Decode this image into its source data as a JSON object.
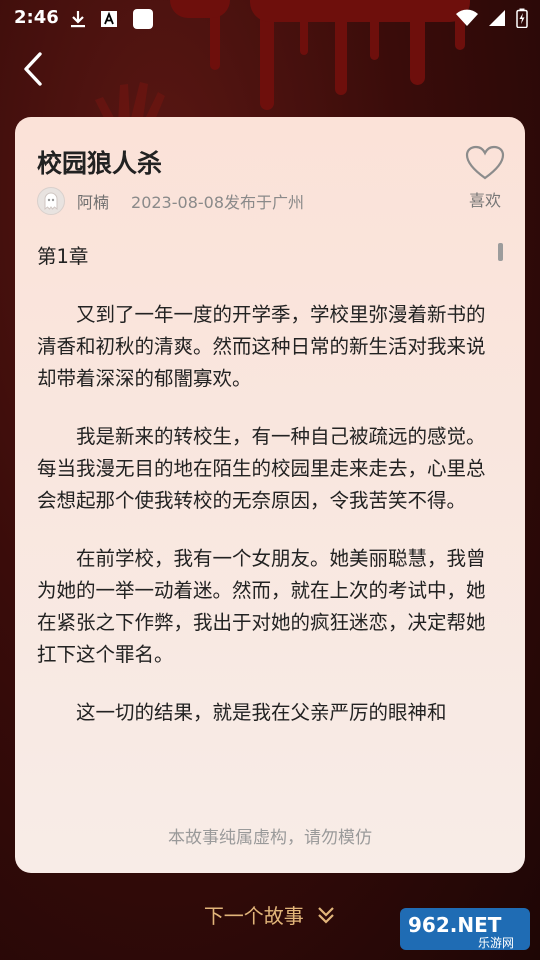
{
  "status_bar": {
    "time": "2:46",
    "icons_left": [
      "download-icon",
      "text-a-icon",
      "square-icon"
    ],
    "icons_right": [
      "wifi-icon",
      "signal-icon",
      "battery-icon"
    ]
  },
  "header": {
    "back_icon": "chevron-left-icon"
  },
  "story": {
    "title": "校园狼人杀",
    "like_label": "喜欢",
    "author": "阿楠",
    "published": "2023-08-08发布于广州",
    "chapter": "第1章",
    "paragraphs": [
      "又到了一年一度的开学季，学校里弥漫着新书的清香和初秋的清爽。然而这种日常的新生活对我来说却带着深深的郁闇寡欢。",
      "我是新来的转校生，有一种自己被疏远的感觉。每当我漫无目的地在陌生的校园里走来走去，心里总会想起那个使我转校的无奈原因，令我苦笑不得。",
      "在前学校，我有一个女朋友。她美丽聪慧，我曾为她的一举一动着迷。然而，就在上次的考试中，她在紧张之下作弊，我出于对她的疯狂迷恋，决定帮她扛下这个罪名。",
      "这一切的结果，就是我在父亲严厉的眼神和"
    ],
    "disclaimer": "本故事纯属虚构，请勿模仿"
  },
  "footer": {
    "next_label": "下一个故事"
  },
  "watermark": {
    "brand": "962.NET",
    "sub": "乐游网"
  },
  "colors": {
    "accent": "#e2b57a",
    "card_bg": "#f9e6de",
    "background": "#3a0c0a"
  }
}
